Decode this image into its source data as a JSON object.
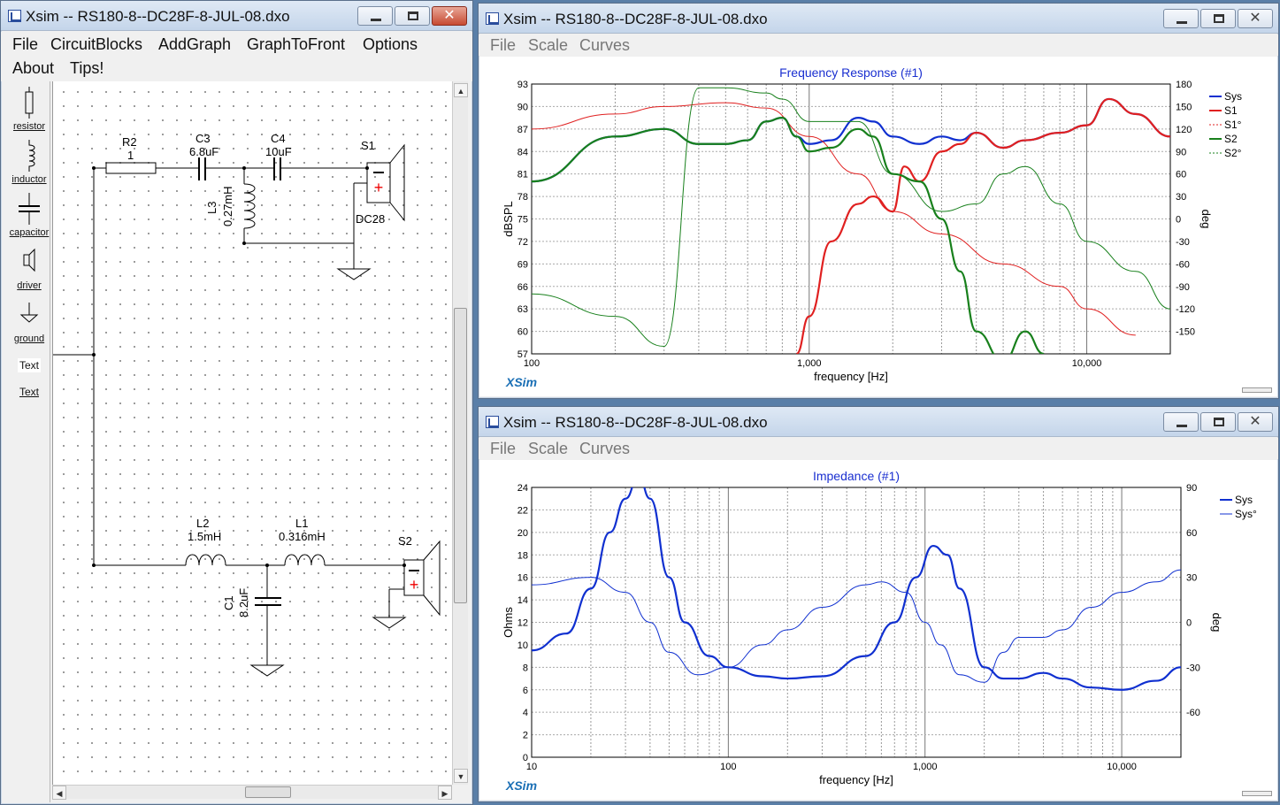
{
  "schematic_window": {
    "title": "Xsim -- RS180-8--DC28F-8-JUL-08.dxo",
    "menu": [
      "File",
      "CircuitBlocks",
      "AddGraph",
      "GraphToFront",
      "Options",
      "About",
      "Tips!"
    ],
    "tools": [
      {
        "label": "resistor",
        "icon": "resistor-icon"
      },
      {
        "label": "inductor",
        "icon": "inductor-icon"
      },
      {
        "label": "capacitor",
        "icon": "capacitor-icon"
      },
      {
        "label": "driver",
        "icon": "driver-icon"
      },
      {
        "label": "ground",
        "icon": "ground-icon"
      },
      {
        "label": "Text",
        "icon": "text-icon"
      },
      {
        "label": "Text",
        "icon": "text-link"
      }
    ],
    "components": {
      "r2": {
        "name": "R2",
        "value": "1"
      },
      "c3": {
        "name": "C3",
        "value": "6.8uF"
      },
      "c4": {
        "name": "C4",
        "value": "10uF"
      },
      "l3": {
        "name": "L3",
        "value": "0.27mH"
      },
      "s1": {
        "name": "S1",
        "model": "DC28"
      },
      "l2": {
        "name": "L2",
        "value": "1.5mH"
      },
      "l1": {
        "name": "L1",
        "value": "0.316mH"
      },
      "c1": {
        "name": "C1",
        "value": "8.2uF"
      },
      "s2": {
        "name": "S2"
      }
    }
  },
  "freq_window": {
    "title": "Xsim -- RS180-8--DC28F-8-JUL-08.dxo",
    "menu": [
      "File",
      "Scale",
      "Curves"
    ],
    "brand": "XSim",
    "chart_data": {
      "type": "line",
      "title": "Frequency Response (#1)",
      "xlabel": "frequency [Hz]",
      "ylabel": "dBSPL",
      "y2label": "deg",
      "x_scale": "log",
      "xlim": [
        100,
        20000
      ],
      "ylim": [
        57,
        93
      ],
      "y2lim": [
        -180,
        180
      ],
      "xticks": [
        "100",
        "1,000",
        "10,000"
      ],
      "yticks": [
        "93",
        "90",
        "87",
        "84",
        "81",
        "78",
        "75",
        "72",
        "69",
        "66",
        "63",
        "60",
        "57"
      ],
      "y2ticks": [
        "180",
        "150",
        "120",
        "90",
        "60",
        "30",
        "0",
        "-30",
        "-60",
        "-90",
        "-120",
        "-150"
      ],
      "legend_position": "top-right",
      "series": [
        {
          "name": "Sys",
          "color": "#1030d0",
          "axis": "left",
          "x": [
            100,
            200,
            300,
            400,
            500,
            600,
            700,
            800,
            900,
            1000,
            1200,
            1500,
            1700,
            2000,
            2500,
            3000,
            3500,
            4000,
            5000,
            6000,
            8000,
            10000,
            12000,
            15000,
            20000
          ],
          "y": [
            80,
            86,
            87,
            85,
            85,
            85.5,
            88,
            88.5,
            86,
            85,
            85.5,
            88.5,
            88,
            86,
            85,
            86,
            85.5,
            86.5,
            84.5,
            85.5,
            86.5,
            87.5,
            91,
            89,
            86
          ]
        },
        {
          "name": "S1",
          "color": "#e02020",
          "axis": "left",
          "x": [
            900,
            1000,
            1200,
            1500,
            1700,
            2000,
            2200,
            2500,
            3000,
            3500,
            4000,
            5000,
            6000,
            8000,
            10000,
            12000,
            15000,
            20000
          ],
          "y": [
            57,
            62,
            72,
            77,
            78,
            76,
            82,
            80,
            84,
            85,
            86.5,
            84.5,
            85.5,
            86.5,
            87.5,
            91,
            89,
            86
          ]
        },
        {
          "name": "S1°",
          "color": "#e02020",
          "axis": "right",
          "dashed": true,
          "x": [
            100,
            200,
            300,
            500,
            700,
            1000,
            1500,
            2000,
            3000,
            5000,
            8000,
            10000,
            15000
          ],
          "y": [
            120,
            140,
            150,
            155,
            148,
            110,
            60,
            10,
            -20,
            -60,
            -90,
            -120,
            -155
          ]
        },
        {
          "name": "S2",
          "color": "#18801c",
          "axis": "left",
          "x": [
            100,
            200,
            300,
            400,
            500,
            600,
            700,
            800,
            900,
            1000,
            1200,
            1500,
            1700,
            2000,
            2500,
            3000,
            3500,
            4000,
            5000,
            6000,
            7000
          ],
          "y": [
            80,
            86,
            87,
            85,
            85,
            85.5,
            88,
            88.5,
            86,
            84,
            84.5,
            87,
            86,
            81,
            80,
            75,
            68,
            60,
            56,
            60,
            57
          ]
        },
        {
          "name": "S2°",
          "color": "#18801c",
          "axis": "right",
          "dashed": true,
          "x": [
            100,
            200,
            300,
            400,
            500,
            700,
            800,
            1000,
            1500,
            2000,
            3000,
            4000,
            5000,
            6000,
            8000,
            10000,
            15000,
            20000
          ],
          "y": [
            -100,
            -130,
            -170,
            175,
            175,
            168,
            160,
            130,
            130,
            60,
            10,
            20,
            60,
            70,
            20,
            -30,
            -70,
            -120
          ]
        }
      ]
    }
  },
  "imp_window": {
    "title": "Xsim -- RS180-8--DC28F-8-JUL-08.dxo",
    "menu": [
      "File",
      "Scale",
      "Curves"
    ],
    "brand": "XSim",
    "chart_data": {
      "type": "line",
      "title": "Impedance (#1)",
      "xlabel": "frequency [Hz]",
      "ylabel": "Ohms",
      "y2label": "deg",
      "x_scale": "log",
      "xlim": [
        10,
        20000
      ],
      "ylim": [
        0,
        24
      ],
      "y2lim": [
        -90,
        90
      ],
      "xticks": [
        "10",
        "100",
        "1,000",
        "10,000"
      ],
      "yticks": [
        "24",
        "22",
        "20",
        "18",
        "16",
        "14",
        "12",
        "10",
        "8",
        "6",
        "4",
        "2",
        "0"
      ],
      "y2ticks": [
        "90",
        "60",
        "30",
        "0",
        "-30",
        "-60"
      ],
      "legend_position": "top-right",
      "series": [
        {
          "name": "Sys",
          "color": "#1030d0",
          "axis": "left",
          "x": [
            10,
            15,
            20,
            25,
            30,
            35,
            40,
            50,
            60,
            80,
            100,
            150,
            200,
            300,
            500,
            700,
            900,
            1100,
            1300,
            1500,
            2000,
            2500,
            3000,
            4000,
            5000,
            7000,
            10000,
            15000,
            20000
          ],
          "y": [
            9.5,
            11,
            15,
            20,
            23,
            25,
            23,
            16,
            12,
            9,
            8,
            7.2,
            7,
            7.2,
            9,
            12,
            16,
            18.8,
            18,
            15,
            8,
            7,
            7,
            7.5,
            7,
            6.2,
            6,
            6.8,
            8
          ]
        },
        {
          "name": "Sys°",
          "color": "#1030d0",
          "axis": "right",
          "dashed": false,
          "x": [
            10,
            20,
            30,
            40,
            50,
            70,
            100,
            150,
            200,
            300,
            500,
            600,
            800,
            1000,
            1200,
            1500,
            2000,
            2500,
            3000,
            4000,
            5000,
            7000,
            10000,
            15000,
            20000
          ],
          "y": [
            25,
            30,
            20,
            0,
            -20,
            -35,
            -30,
            -15,
            -5,
            10,
            25,
            27,
            20,
            0,
            -15,
            -35,
            -40,
            -20,
            -10,
            -10,
            -5,
            10,
            20,
            27,
            35
          ]
        }
      ]
    }
  }
}
